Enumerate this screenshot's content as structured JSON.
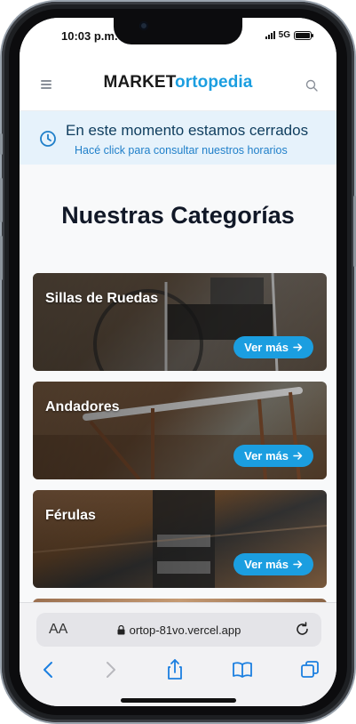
{
  "status_bar": {
    "time": "10:03 p.m.",
    "network": "5G"
  },
  "header": {
    "logo_part1": "MARKET",
    "logo_part2": "ortopedia"
  },
  "banner": {
    "title": "En este momento estamos cerrados",
    "subtitle": "Hacé click para consultar nuestros horarios"
  },
  "section": {
    "title": "Nuestras Categorías"
  },
  "categories": [
    {
      "name": "Sillas de Ruedas",
      "button": "Ver más"
    },
    {
      "name": "Andadores",
      "button": "Ver más"
    },
    {
      "name": "Férulas",
      "button": "Ver más"
    }
  ],
  "browser": {
    "url": "ortop-81vo.vercel.app",
    "text_size_label": "AA"
  },
  "colors": {
    "accent": "#1b9ee0",
    "banner_bg": "#e6f2fb",
    "banner_text": "#0f3d5e"
  },
  "icons": [
    "menu-icon",
    "search-icon",
    "clock-icon",
    "arrow-right-icon",
    "lock-icon",
    "reload-icon",
    "back-icon",
    "forward-icon",
    "share-icon",
    "bookmarks-icon",
    "tabs-icon"
  ]
}
